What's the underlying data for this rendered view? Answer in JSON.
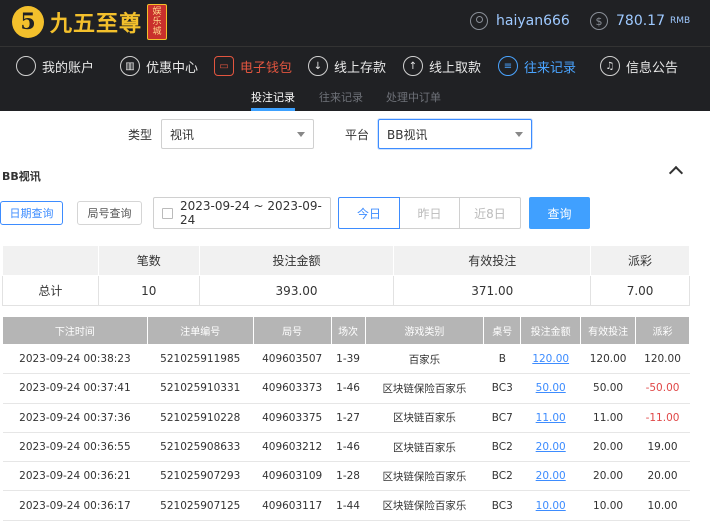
{
  "header": {
    "logo_mark": "5",
    "logo_text": "九五至尊",
    "logo_tag": [
      "娱",
      "乐",
      "城"
    ],
    "username": "haiyan666",
    "balance": "780.17",
    "balance_unit": "RMB",
    "user_icon": "user-icon",
    "balance_icon": "dollar-icon"
  },
  "nav": [
    {
      "label": "我的账户",
      "icon": "user-icon"
    },
    {
      "label": "优惠中心",
      "icon": "gift-icon"
    },
    {
      "label": "电子钱包",
      "icon": "wallet-icon"
    },
    {
      "label": "线上存款",
      "icon": "deposit-icon"
    },
    {
      "label": "线上取款",
      "icon": "withdraw-icon"
    },
    {
      "label": "往来记录",
      "icon": "records-icon"
    },
    {
      "label": "信息公告",
      "icon": "bell-icon"
    }
  ],
  "subnav": [
    "投注记录",
    "往来记录",
    "处理中订单"
  ],
  "filters": {
    "type_label": "类型",
    "type_value": "视讯",
    "platform_label": "平台",
    "platform_value": "BB视讯"
  },
  "section": {
    "title": "BB视讯"
  },
  "search": {
    "date_query": "日期查询",
    "round_query": "局号查询",
    "date_range": "2023-09-24 ~ 2023-09-24",
    "today": "今日",
    "yesterday": "昨日",
    "last8": "近8日",
    "query_button": "查询"
  },
  "summary": {
    "headers": [
      "",
      "笔数",
      "投注金额",
      "有效投注",
      "派彩"
    ],
    "row": [
      "总计",
      "10",
      "393.00",
      "371.00",
      "7.00"
    ]
  },
  "detail": {
    "headers": [
      "下注时间",
      "注单编号",
      "局号",
      "场次",
      "游戏类别",
      "桌号",
      "投注金额",
      "有效投注",
      "派彩"
    ],
    "rows": [
      [
        "2023-09-24 00:38:23",
        "521025911985",
        "409603507",
        "1-39",
        "百家乐",
        "B",
        "120.00",
        "120.00",
        "120.00"
      ],
      [
        "2023-09-24 00:37:41",
        "521025910331",
        "409603373",
        "1-46",
        "区块链保险百家乐",
        "BC3",
        "50.00",
        "50.00",
        "-50.00"
      ],
      [
        "2023-09-24 00:37:36",
        "521025910228",
        "409603375",
        "1-27",
        "区块链百家乐",
        "BC7",
        "11.00",
        "11.00",
        "-11.00"
      ],
      [
        "2023-09-24 00:36:55",
        "521025908633",
        "409603212",
        "1-46",
        "区块链百家乐",
        "BC2",
        "20.00",
        "20.00",
        "19.00"
      ],
      [
        "2023-09-24 00:36:21",
        "521025907293",
        "409603109",
        "1-28",
        "区块链保险百家乐",
        "BC2",
        "20.00",
        "20.00",
        "20.00"
      ],
      [
        "2023-09-24 00:36:17",
        "521025907125",
        "409603117",
        "1-44",
        "区块链保险百家乐",
        "BC3",
        "10.00",
        "10.00",
        "10.00"
      ]
    ]
  }
}
